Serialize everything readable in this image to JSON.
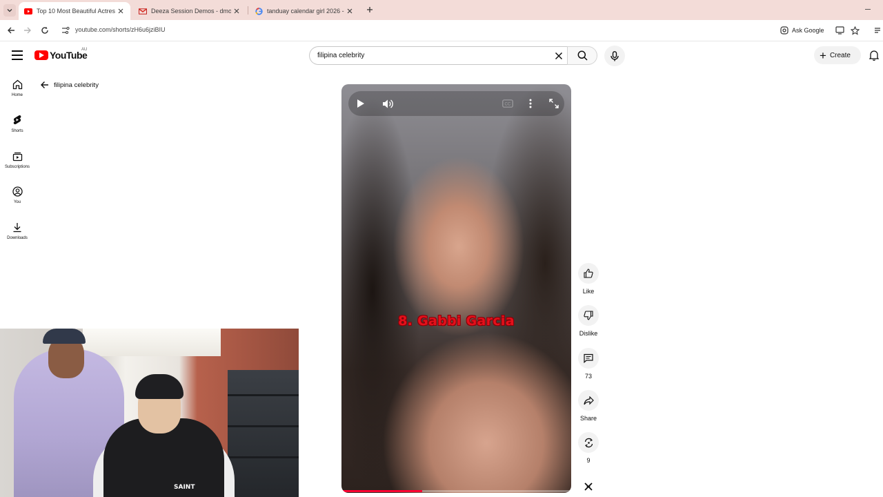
{
  "browser": {
    "tabs": [
      {
        "title": "Top 10 Most Beautiful Actress I",
        "active": true,
        "favicon": "youtube-favicon"
      },
      {
        "title": "Deeza Session Demos - dmosu",
        "active": false,
        "favicon": "gmail-favicon"
      },
      {
        "title": "tanduay calendar girl 2026 - Go",
        "active": false,
        "favicon": "google-favicon"
      }
    ],
    "url": "youtube.com/shorts/zH6u6jziBIU",
    "ask_google": "Ask Google"
  },
  "masthead": {
    "logo_text": "YouTube",
    "country": "AU",
    "search_query": "filipina celebrity",
    "create_label": "Create"
  },
  "guide": {
    "items": [
      {
        "label": "Home",
        "icon": "home-icon"
      },
      {
        "label": "Shorts",
        "icon": "shorts-icon"
      },
      {
        "label": "Subscriptions",
        "icon": "subscriptions-icon"
      },
      {
        "label": "You",
        "icon": "you-icon"
      },
      {
        "label": "Downloads",
        "icon": "download-icon"
      }
    ]
  },
  "search_back": {
    "label": "filipina celebrity"
  },
  "player": {
    "caption": "8. Gabbi Garcia",
    "progress_fraction": 0.35
  },
  "actions": {
    "like": "Like",
    "dislike": "Dislike",
    "comments": "73",
    "share": "Share",
    "remix": "9"
  },
  "webcam": {
    "shirt_text": "SAINT"
  },
  "colors": {
    "brand_red": "#ff0000",
    "caption_red": "#e4101b",
    "progress_red": "#ff0033",
    "tabstrip": "#f3dcd8"
  }
}
